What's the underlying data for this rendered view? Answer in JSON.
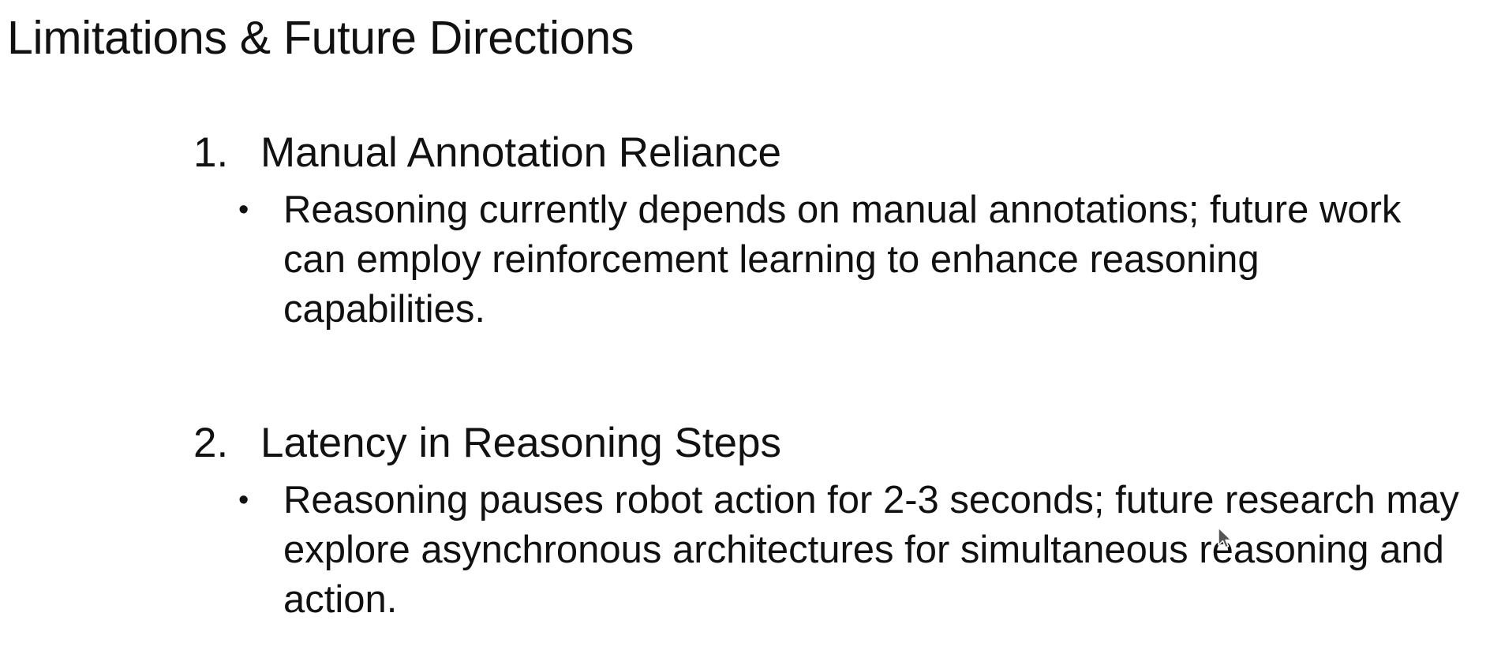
{
  "slide": {
    "title": "Limitations & Future Directions",
    "sections": [
      {
        "number": "1.",
        "heading": "Manual Annotation Reliance",
        "bullet_mark": "•",
        "bullet": "Reasoning currently depends on manual annotations; future work can employ reinforcement learning to enhance reasoning capabilities."
      },
      {
        "number": "2.",
        "heading": "Latency in Reasoning Steps",
        "bullet_mark": "•",
        "bullet": "Reasoning pauses robot action for 2-3 seconds; future research may explore asynchronous architectures for simultaneous reasoning and action."
      }
    ]
  },
  "cursor": {
    "icon": "mouse-pointer-icon",
    "color": "#555555"
  }
}
